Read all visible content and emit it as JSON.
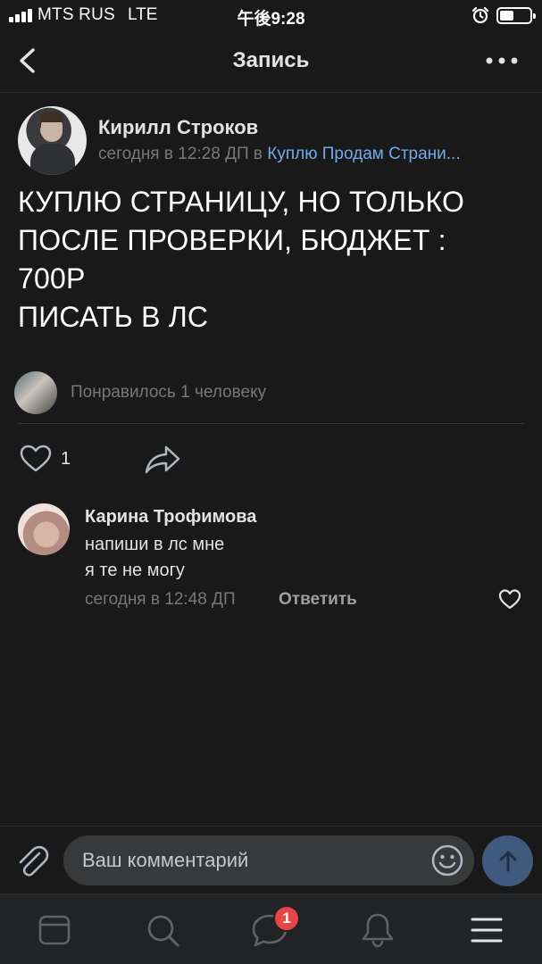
{
  "status_bar": {
    "carrier": "MTS RUS",
    "network": "LTE",
    "time": "午後9:28"
  },
  "header": {
    "title": "Запись"
  },
  "post": {
    "author": "Кирилл Строков",
    "time": "сегодня в 12:28 ДП в",
    "group": "Куплю Продам Страни...",
    "text_lines": [
      "КУПЛЮ СТРАНИЦУ, НО ТОЛЬКО",
      "ПОСЛЕ ПРОВЕРКИ, БЮДЖЕТ :",
      "700Р",
      "ПИСАТЬ В ЛС"
    ],
    "likes_summary": "Понравилось 1 человеку",
    "like_count": "1"
  },
  "comments": [
    {
      "author": "Карина Трофимова",
      "lines": [
        "напиши в лс мне",
        "я те не могу"
      ],
      "time": "сегодня в 12:48 ДП",
      "reply_label": "Ответить"
    }
  ],
  "composer": {
    "placeholder": "Ваш комментарий"
  },
  "tab_bar": {
    "messages_badge": "1",
    "icons": [
      "feed-icon",
      "search-icon",
      "messages-icon",
      "notifications-icon",
      "menu-icon"
    ]
  },
  "colors": {
    "background": "#19191a",
    "link": "#71aaeb",
    "secondary_text": "#76787a",
    "badge": "#e64646",
    "send_button": "#3f5a7d"
  }
}
